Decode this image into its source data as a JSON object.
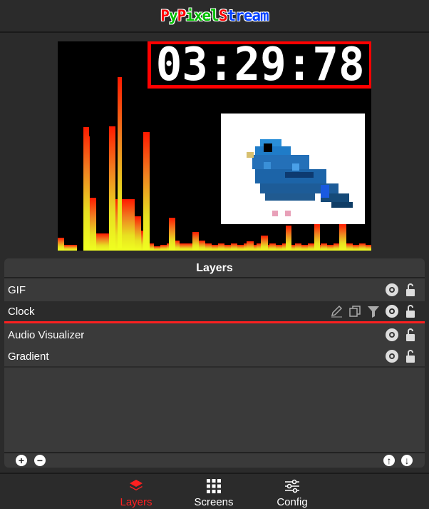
{
  "app": {
    "title_parts": [
      {
        "text": "P",
        "color": "#ff0000"
      },
      {
        "text": "y",
        "color": "#00c000"
      },
      {
        "text": "P",
        "color": "#ff0000"
      },
      {
        "text": "ixel",
        "color": "#00c000"
      },
      {
        "text": "S",
        "color": "#ff0000"
      },
      {
        "text": "tream",
        "color": "#0040ff"
      }
    ]
  },
  "preview": {
    "clock_text": "03:29:78",
    "accent_color": "#ff0000"
  },
  "layers_panel": {
    "title": "Layers",
    "layers": [
      {
        "name": "GIF",
        "selected": false
      },
      {
        "name": "Clock",
        "selected": true
      },
      {
        "name": "Audio Visualizer",
        "selected": false
      },
      {
        "name": "Gradient",
        "selected": false
      }
    ],
    "row_icons": [
      "eye-icon",
      "unlock-icon"
    ],
    "selected_extra_icons": [
      "edit-icon",
      "duplicate-icon",
      "filter-icon"
    ],
    "footer": {
      "add_icon": "plus-icon",
      "remove_icon": "minus-icon",
      "move_up_icon": "arrow-up-icon",
      "move_down_icon": "arrow-down-icon"
    }
  },
  "nav": {
    "items": [
      {
        "label": "Layers",
        "icon": "layers-icon",
        "active": true
      },
      {
        "label": "Screens",
        "icon": "grid-icon",
        "active": false
      },
      {
        "label": "Config",
        "icon": "sliders-icon",
        "active": false
      }
    ],
    "active_color": "#ff2020"
  }
}
